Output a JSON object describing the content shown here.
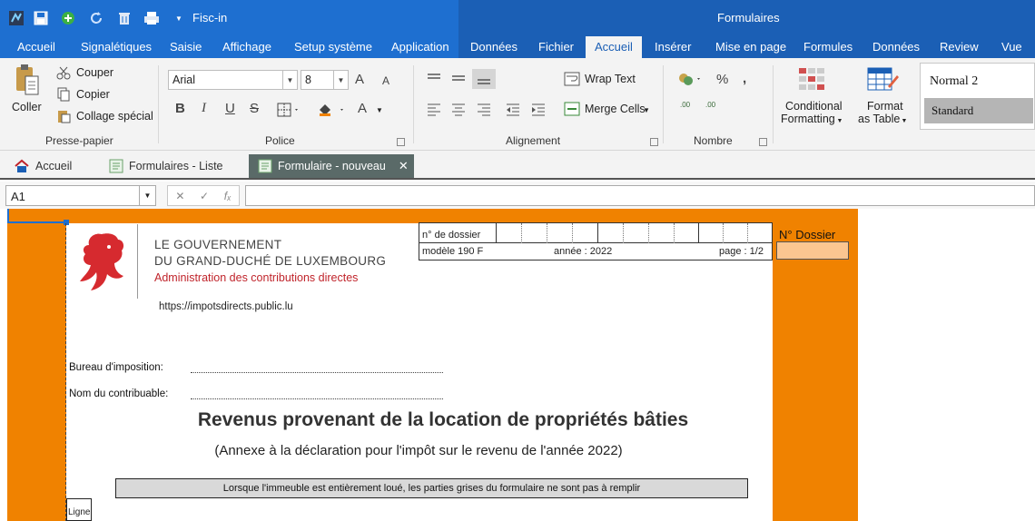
{
  "titlebar": {
    "app_name": "Fisc-in",
    "window_title": "Formulaires",
    "qat": [
      "app-icon",
      "save-icon",
      "add-icon",
      "refresh-icon",
      "trash-icon",
      "print-icon",
      "customize-icon"
    ]
  },
  "ribbon_tabs": {
    "left": [
      "Accueil",
      "Signalétiques",
      "Saisie",
      "Affichage",
      "Setup système",
      "Application"
    ],
    "right": [
      "Données",
      "Fichier",
      "Accueil",
      "Insérer",
      "Mise en page",
      "Formules",
      "Données",
      "Review",
      "Vue"
    ],
    "active": "Accueil"
  },
  "clipboard": {
    "paste": "Coller",
    "cut": "Couper",
    "copy": "Copier",
    "paste_special": "Collage spécial",
    "group": "Presse-papier"
  },
  "font": {
    "family": "Arial",
    "size": "8",
    "group": "Police",
    "bold": "B",
    "italic": "I",
    "underline": "U",
    "strike": "S",
    "grow": "A",
    "shrink": "A",
    "font_color": "A"
  },
  "alignment": {
    "wrap": "Wrap Text",
    "merge": "Merge Cells",
    "group": "Alignement"
  },
  "number": {
    "percent": "%",
    "comma": "ʙ",
    "inc_decimal": ".00",
    "dec_decimal": ".00",
    "group": "Nombre"
  },
  "styles": {
    "conditional_1": "Conditional",
    "conditional_2": "Formatting",
    "table_1": "Format",
    "table_2": "as Table",
    "style_1": "Normal 2",
    "style_2": "Standard"
  },
  "doc_tabs": [
    {
      "label": "Accueil"
    },
    {
      "label": "Formulaires - Liste"
    },
    {
      "label": "Formulaire - nouveau"
    }
  ],
  "formula_bar": {
    "cell_ref": "A1",
    "cancel": "✕",
    "confirm": "✓",
    "fx": "fₓ",
    "content": ""
  },
  "form": {
    "gov_line1": "LE GOUVERNEMENT",
    "gov_line2": "DU GRAND-DUCHÉ DE LUXEMBOURG",
    "gov_line3": "Administration des contributions directes",
    "url": "https://impotsdirects.public.lu",
    "dossier_label": "n° de dossier",
    "model": "modèle 190 F",
    "year": "année : 2022",
    "page": "page : 1/2",
    "n_dossier": "N° Dossier",
    "bureau_label": "Bureau d'imposition:",
    "nom_label": "Nom du contribuable:",
    "title": "Revenus provenant de la location de propriétés bâties",
    "subtitle": "(Annexe à la déclaration pour l'impôt sur le revenu de l'année 2022)",
    "note": "Lorsque l'immeuble est entièrement loué, les parties grises du formulaire ne sont pas à remplir",
    "ligne": "Ligne"
  },
  "colors": {
    "accent": "#1e6fd0",
    "sheet_orange": "#f08200",
    "dossier_fill": "#fbc690",
    "lux_red": "#c0242b"
  }
}
